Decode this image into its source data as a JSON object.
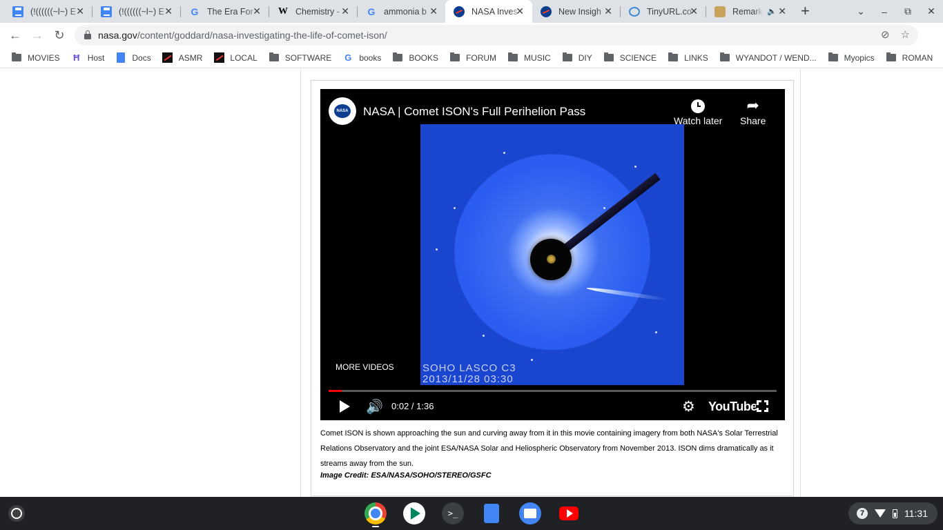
{
  "tabs": [
    {
      "title": "(!((((((~l~) E",
      "icon": "google-docs-icon"
    },
    {
      "title": "(!((((((~l~) E",
      "icon": "google-docs-icon"
    },
    {
      "title": "The Era For",
      "icon": "google-icon"
    },
    {
      "title": "Chemistry -",
      "icon": "wikipedia-icon"
    },
    {
      "title": "ammonia b",
      "icon": "google-icon"
    },
    {
      "title": "NASA Inves",
      "icon": "nasa-icon",
      "active": true
    },
    {
      "title": "New Insigh",
      "icon": "nasa-icon"
    },
    {
      "title": "TinyURL.co",
      "icon": "tinyurl-icon"
    },
    {
      "title": "Remark",
      "icon": "remark-icon",
      "audio": true
    }
  ],
  "window_controls": {
    "tab_search": "⌄",
    "minimize": "–",
    "restore": "⧉",
    "close": "✕"
  },
  "toolbar": {
    "url_domain": "nasa.gov",
    "url_path": "/content/goddard/nasa-investigating-the-life-of-comet-ison/"
  },
  "bookmarks": [
    {
      "label": "MOVIES",
      "icon": "folder-icon"
    },
    {
      "label": "Host",
      "icon": "host-icon"
    },
    {
      "label": "Docs",
      "icon": "docs-icon"
    },
    {
      "label": "ASMR",
      "icon": "asmr-icon"
    },
    {
      "label": "LOCAL",
      "icon": "local-icon"
    },
    {
      "label": "SOFTWARE",
      "icon": "folder-icon"
    },
    {
      "label": "books",
      "icon": "google-icon"
    },
    {
      "label": "BOOKS",
      "icon": "folder-icon"
    },
    {
      "label": "FORUM",
      "icon": "folder-icon"
    },
    {
      "label": "MUSIC",
      "icon": "folder-icon"
    },
    {
      "label": "DIY",
      "icon": "folder-icon"
    },
    {
      "label": "SCIENCE",
      "icon": "folder-icon"
    },
    {
      "label": "LINKS",
      "icon": "folder-icon"
    },
    {
      "label": "WYANDOT / WEND...",
      "icon": "folder-icon"
    },
    {
      "label": "Myopics",
      "icon": "folder-icon"
    },
    {
      "label": "ROMAN",
      "icon": "folder-icon"
    }
  ],
  "video": {
    "channel_logo_text": "NASA",
    "title": "NASA | Comet ISON's Full Perihelion Pass",
    "watch_later": "Watch later",
    "share": "Share",
    "more_videos": "MORE VIDEOS",
    "frame_caption_line1": "SOHO LASCO C3",
    "frame_caption_line2": "2013/11/28 03:30",
    "time": "0:02 / 1:36",
    "progress": 0.03,
    "youtube_logo": "YouTube"
  },
  "caption": "Comet ISON is shown approaching the sun and curving away from it in this movie containing imagery from both NASA's Solar Terrestrial Relations Observatory and the joint ESA/NASA Solar and Heliospheric Observatory from November 2013. ISON dims dramatically as it streams away from the sun.",
  "credit": "Image Credit: ESA/NASA/SOHO/STEREO/GSFC",
  "shelf": {
    "apps": [
      "chrome-icon",
      "play-store-icon",
      "terminal-icon",
      "docs-icon",
      "files-icon",
      "youtube-icon"
    ],
    "terminal_glyph": ">_",
    "notification_count": "7",
    "clock": "11:31"
  }
}
